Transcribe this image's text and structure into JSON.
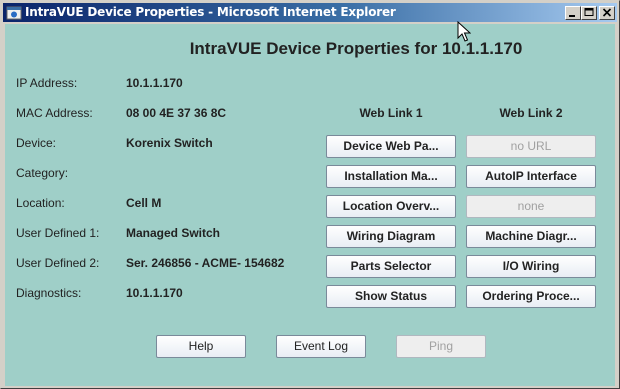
{
  "window": {
    "title": "IntraVUE Device Properties - Microsoft Internet Explorer"
  },
  "page": {
    "heading": "IntraVUE Device Properties for 10.1.1.170"
  },
  "properties": [
    {
      "label": "IP Address:",
      "value": "10.1.1.170"
    },
    {
      "label": "MAC Address:",
      "value": "08 00 4E 37 36 8C"
    },
    {
      "label": "Device:",
      "value": "Korenix Switch"
    },
    {
      "label": "Category:",
      "value": ""
    },
    {
      "label": "Location:",
      "value": "Cell M"
    },
    {
      "label": "User Defined 1:",
      "value": "Managed Switch"
    },
    {
      "label": "User Defined 2:",
      "value": "Ser. 246856 - ACME- 154682"
    },
    {
      "label": "Diagnostics:",
      "value": "10.1.1.170"
    }
  ],
  "weblinks": {
    "col1_header": "Web Link 1",
    "col2_header": "Web Link 2",
    "col1": [
      {
        "label": "Device Web Pa...",
        "enabled": true
      },
      {
        "label": "Installation Ma...",
        "enabled": true
      },
      {
        "label": "Location Overv...",
        "enabled": true
      },
      {
        "label": "Wiring Diagram",
        "enabled": true
      },
      {
        "label": "Parts Selector",
        "enabled": true
      },
      {
        "label": "Show Status",
        "enabled": true
      }
    ],
    "col2": [
      {
        "label": "no URL",
        "enabled": false
      },
      {
        "label": "AutoIP Interface",
        "enabled": true
      },
      {
        "label": "none",
        "enabled": false
      },
      {
        "label": "Machine Diagr...",
        "enabled": true
      },
      {
        "label": "I/O Wiring",
        "enabled": true
      },
      {
        "label": "Ordering Proce...",
        "enabled": true
      }
    ]
  },
  "footer": {
    "help_label": "Help",
    "eventlog_label": "Event Log",
    "ping_label": "Ping"
  },
  "colors": {
    "client_background": "#9fcfc8",
    "titlebar_start": "#0a246a",
    "titlebar_end": "#a6caf0"
  },
  "icons": {
    "app": "internet-explorer-icon",
    "minimize": "minimize-icon",
    "maximize": "maximize-icon",
    "close": "close-icon",
    "cursor": "mouse-pointer-icon"
  }
}
